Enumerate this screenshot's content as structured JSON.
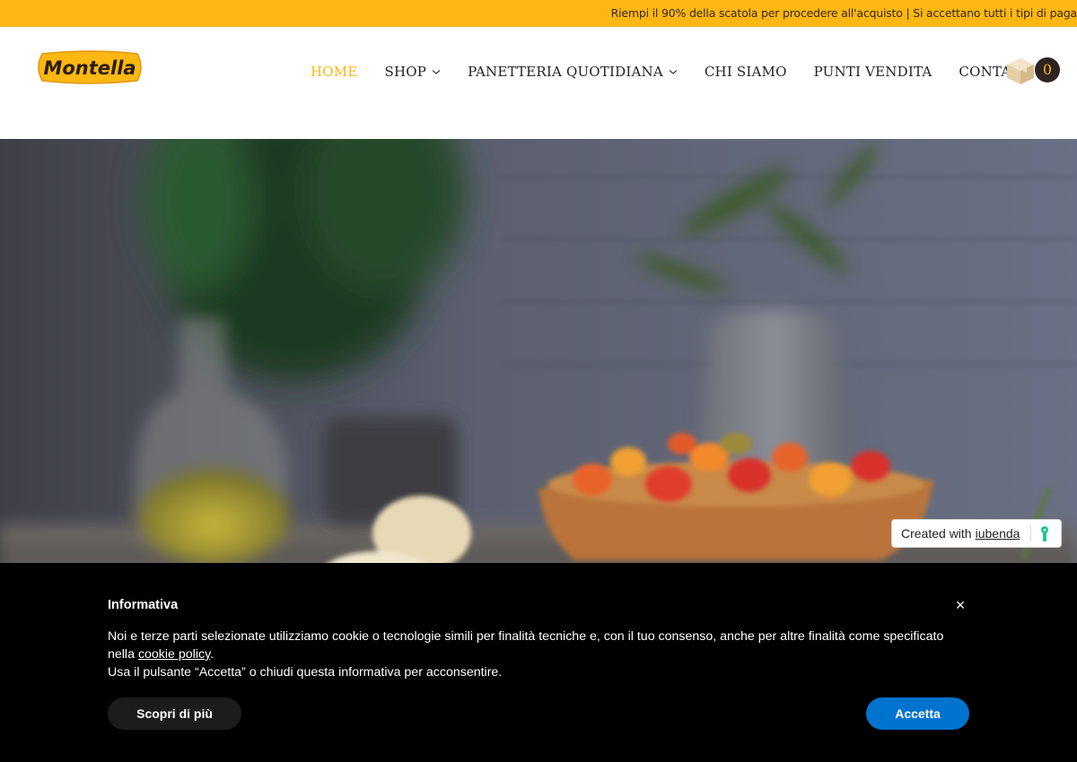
{
  "topbar": {
    "message": "Riempi il 90% della scatola per procedere all'acquisto | Si accettano tutti i tipi di paga"
  },
  "header": {
    "logo_text": "Montella",
    "nav": [
      {
        "label": "HOME",
        "active": true,
        "has_dropdown": false
      },
      {
        "label": "SHOP",
        "active": false,
        "has_dropdown": true
      },
      {
        "label": "PANETTERIA QUOTIDIANA",
        "active": false,
        "has_dropdown": true
      },
      {
        "label": "CHI SIAMO",
        "active": false,
        "has_dropdown": false
      },
      {
        "label": "PUNTI VENDITA",
        "active": false,
        "has_dropdown": false
      },
      {
        "label": "CONTATTI",
        "active": false,
        "has_dropdown": false
      }
    ],
    "cart": {
      "icon": "box-icon",
      "count": "0"
    }
  },
  "iubenda_badge": {
    "text": "Created with",
    "link": "iubenda"
  },
  "cookie_banner": {
    "title": "Informativa",
    "close_label": "×",
    "body_line1": "Noi e terze parti selezionate utilizziamo cookie o tecnologie simili per finalità tecniche e, con il tuo consenso, anche per altre finalità come specificato nella",
    "policy_link": "cookie policy",
    "body_line1_end": ".",
    "body_line2": "Usa il pulsante “Accetta” o chiudi questa informativa per acconsentire.",
    "more_button": "Scopri di più",
    "accept_button": "Accetta"
  },
  "colors": {
    "brand_yellow": "#fcb713",
    "accept_blue": "#0073ce",
    "dark_text": "#231f20"
  }
}
